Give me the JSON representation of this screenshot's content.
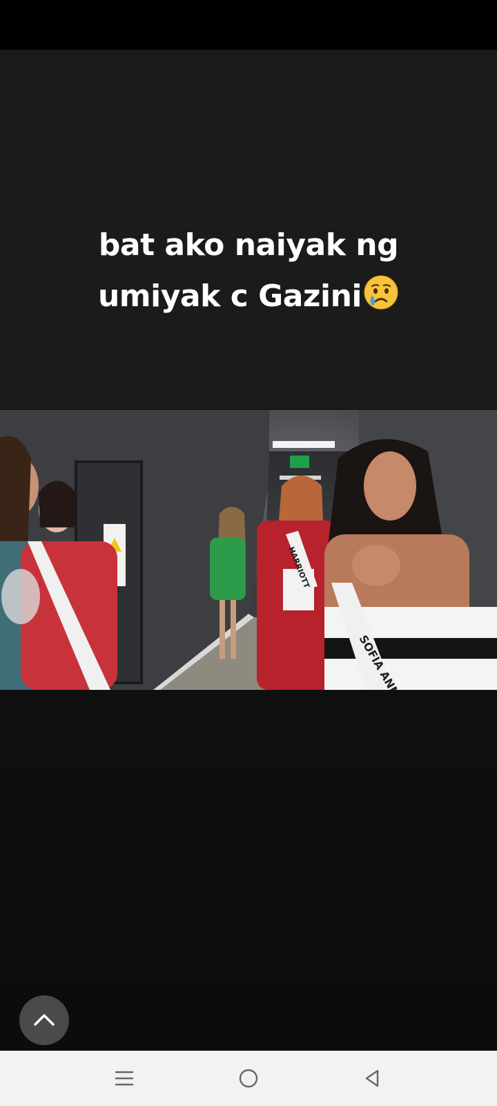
{
  "caption": {
    "line1": "bat ako naiyak ng",
    "line2": "umiyak c Gazini"
  },
  "caption_emoji": "crying-face",
  "video": {
    "sash_texts": [
      "HARRIOTT",
      "SOFIA ANN"
    ]
  },
  "scroll_top_icon": "chevron-up-icon",
  "navigation": {
    "recents_icon": "menu-lines-icon",
    "home_icon": "circle-home-icon",
    "back_icon": "triangle-back-icon"
  },
  "colors": {
    "background": "#1b1b1b",
    "caption": "#ffffff",
    "nav_bar": "#f2f2f2",
    "scroll_button": "#4a4a4a"
  }
}
